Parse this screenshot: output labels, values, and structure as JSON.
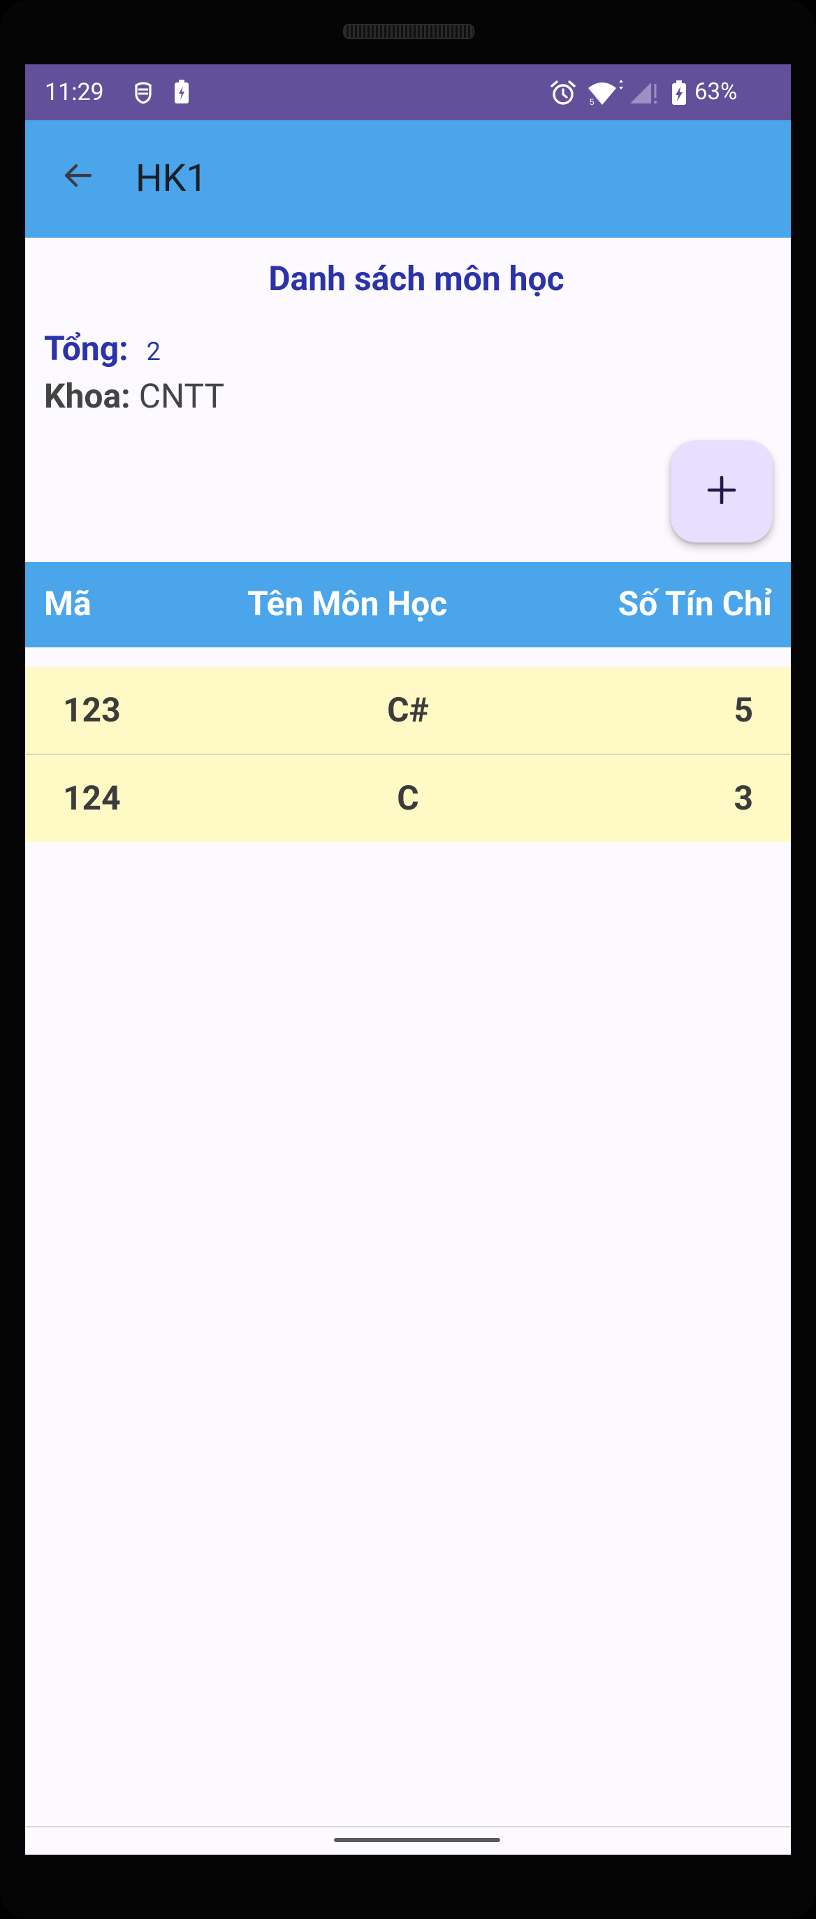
{
  "status_bar": {
    "time": "11:29",
    "battery_percent": "63%",
    "icons": [
      "privacy-icon",
      "battery-saver-icon",
      "alarm-icon",
      "wifi-icon",
      "cell-signal-icon",
      "battery-charging-icon"
    ]
  },
  "app_bar": {
    "title": "HK1",
    "back_icon": "arrow-back-icon"
  },
  "content": {
    "list_title": "Danh sách môn học",
    "total_label": "Tổng:",
    "total_value": "2",
    "dept_label": "Khoa:",
    "dept_value": "CNTT",
    "fab_icon": "plus-icon",
    "fab_label": "+"
  },
  "table": {
    "headers": [
      "Mã",
      "Tên Môn Học",
      "Số Tín Chỉ"
    ],
    "rows": [
      {
        "code": "123",
        "name": "C#",
        "credits": "5"
      },
      {
        "code": "124",
        "name": "C",
        "credits": "3"
      }
    ]
  },
  "colors": {
    "status_bar": "#62509b",
    "app_bar": "#4aa5eb",
    "title_blue": "#2c32a9",
    "row_background": "#fff9c6",
    "fab_background": "#e7dffd"
  }
}
